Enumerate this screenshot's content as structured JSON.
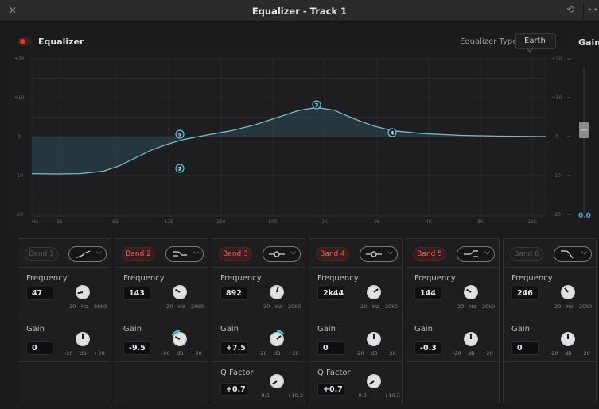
{
  "window": {
    "title": "Equalizer - Track 1",
    "close_icon": "close-icon",
    "reset_icon": "reset-icon",
    "more_icon": "more-icon"
  },
  "toolbar": {
    "eq_label": "Equalizer",
    "eq_on": true,
    "type_label": "Equalizer Type",
    "type_value": "Earth",
    "gain_label": "Gain"
  },
  "graph": {
    "y_ticks": [
      "+20",
      "+10",
      "0",
      "-10",
      "-20"
    ],
    "x_ticks": [
      "Hz",
      "31",
      "62",
      "125",
      "250",
      "500",
      "1K",
      "2K",
      "4K",
      "8K",
      "16K"
    ],
    "nodes": [
      "2",
      "3",
      "4",
      "5"
    ],
    "curve_color": "#7fb8c8",
    "fill_color": "#2e4a57"
  },
  "master_gain": {
    "value": "0.0"
  },
  "bands": [
    {
      "label": "Band 1",
      "active": false,
      "shape": "high-pass-icon",
      "frequency": "47",
      "gain": "0"
    },
    {
      "label": "Band 2",
      "active": true,
      "shape": "low-shelf-icon",
      "frequency": "143",
      "gain": "-9.5"
    },
    {
      "label": "Band 3",
      "active": true,
      "shape": "bell-icon",
      "frequency": "892",
      "gain": "+7.5",
      "q": "+0.7"
    },
    {
      "label": "Band 4",
      "active": true,
      "shape": "bell-icon",
      "frequency": "2k44",
      "gain": "0",
      "q": "+0.7"
    },
    {
      "label": "Band 5",
      "active": true,
      "shape": "high-shelf-icon",
      "frequency": "144",
      "gain": "-0.3"
    },
    {
      "label": "Band 6",
      "active": false,
      "shape": "low-pass-icon",
      "frequency": "246",
      "gain": "0"
    }
  ],
  "labels": {
    "frequency": "Frequency",
    "gain": "Gain",
    "q": "Q Factor",
    "freq_min": "20",
    "freq_unit": "Hz",
    "freq_max": "20k0",
    "gain_min": "-20",
    "gain_unit": "dB",
    "gain_max": "+20",
    "q_min": "+0.3",
    "q_max": "+10.3"
  }
}
